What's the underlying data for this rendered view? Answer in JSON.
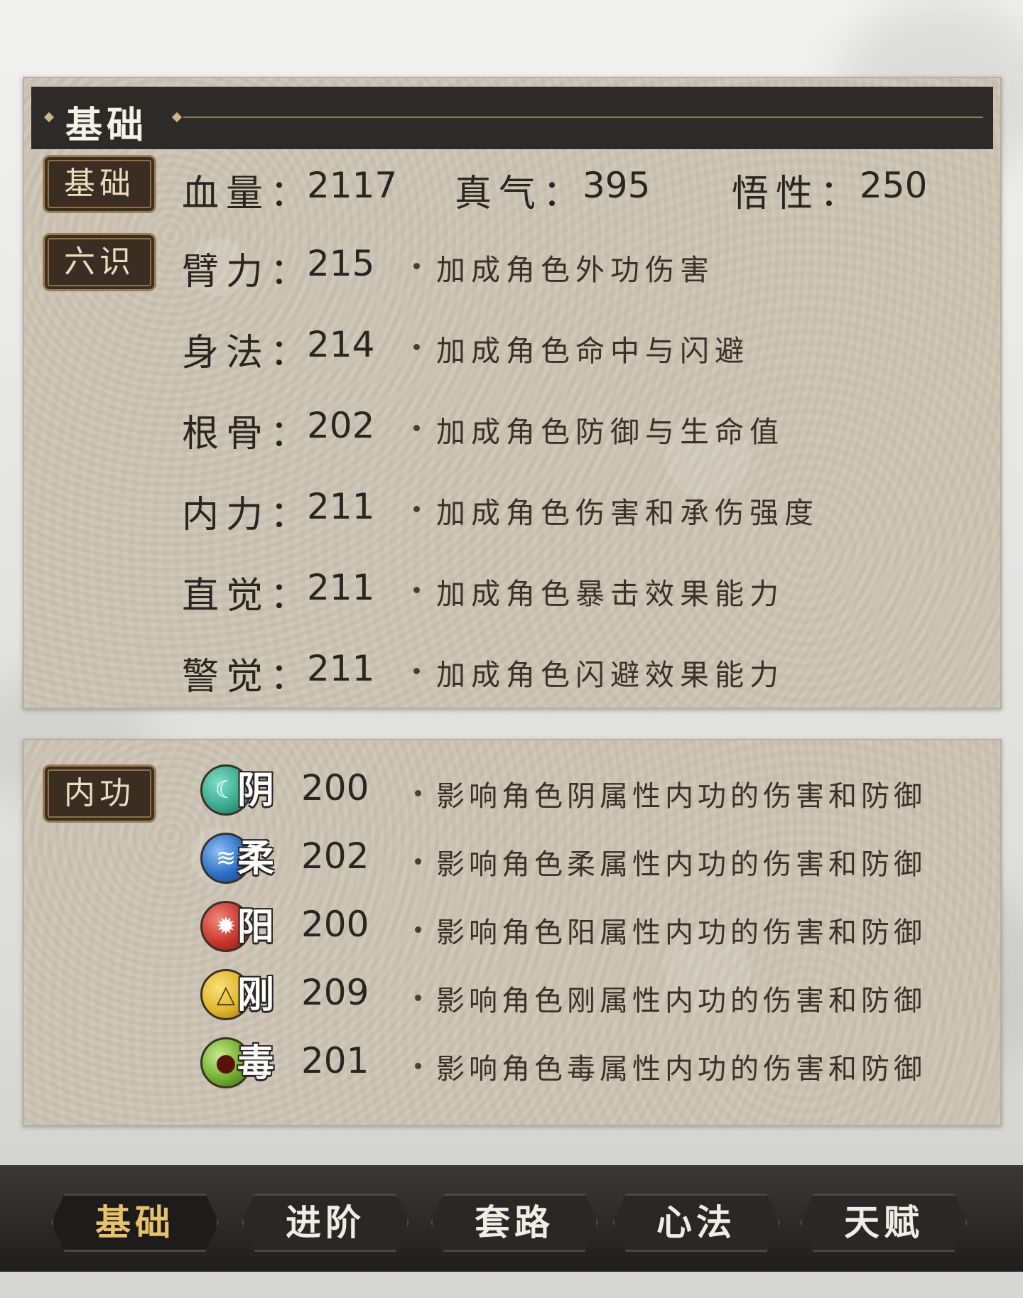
{
  "basic_section": {
    "title": "基础",
    "base_tag": "基础",
    "base_stats": [
      {
        "label": "血量：",
        "value": "2117"
      },
      {
        "label": "真气：",
        "value": "395"
      },
      {
        "label": "悟性：",
        "value": "250"
      }
    ],
    "six_tag": "六识",
    "six_stats": [
      {
        "label": "臂力：",
        "value": "215",
        "desc": "加成角色外功伤害"
      },
      {
        "label": "身法：",
        "value": "214",
        "desc": "加成角色命中与闪避"
      },
      {
        "label": "根骨：",
        "value": "202",
        "desc": "加成角色防御与生命值"
      },
      {
        "label": "内力：",
        "value": "211",
        "desc": "加成角色伤害和承伤强度"
      },
      {
        "label": "直觉：",
        "value": "211",
        "desc": "加成角色暴击效果能力"
      },
      {
        "label": "警觉：",
        "value": "211",
        "desc": "加成角色闪避效果能力"
      }
    ]
  },
  "neigong_section": {
    "tag": "内功",
    "attributes": [
      {
        "char": "阴",
        "value": "200",
        "desc": "影响角色阴属性内功的伤害和防御",
        "color": "#3aa88a",
        "icon": "moon-icon"
      },
      {
        "char": "柔",
        "value": "202",
        "desc": "影响角色柔属性内功的伤害和防御",
        "color": "#2c6fc4",
        "icon": "water-icon"
      },
      {
        "char": "阳",
        "value": "200",
        "desc": "影响角色阳属性内功的伤害和防御",
        "color": "#c8342a",
        "icon": "sun-icon"
      },
      {
        "char": "刚",
        "value": "209",
        "desc": "影响角色刚属性内功的伤害和防御",
        "color": "#e0b62a",
        "icon": "triangle-icon"
      },
      {
        "char": "毒",
        "value": "201",
        "desc": "影响角色毒属性内功的伤害和防御",
        "color": "#6fae2e",
        "icon": "poison-drop-icon"
      }
    ]
  },
  "bottom_nav": {
    "tabs": [
      {
        "label": "基础",
        "active": true
      },
      {
        "label": "进阶",
        "active": false
      },
      {
        "label": "套路",
        "active": false
      },
      {
        "label": "心法",
        "active": false
      },
      {
        "label": "天赋",
        "active": false
      }
    ]
  }
}
